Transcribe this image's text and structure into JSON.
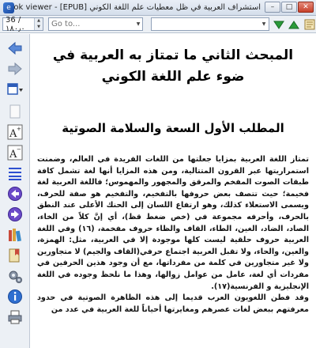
{
  "window": {
    "title": "استشراف العربية في ظل معطيات علم اللغة الكوني [EPUB] - E-book viewer",
    "minimize_glyph": "–",
    "maximize_glyph": "□",
    "close_glyph": "✕"
  },
  "toolbar": {
    "page_value": "36 / ١٨٠٫٠",
    "goto_placeholder": "Go to...",
    "search_value": "",
    "colors": {
      "next_arrow": "#2a9a3a",
      "prev_arrow": "#2a9a3a"
    }
  },
  "sidebar": {
    "items": [
      {
        "name": "back-icon"
      },
      {
        "name": "forward-icon"
      },
      {
        "name": "toggle-toc-icon"
      },
      {
        "name": "copy-icon"
      },
      {
        "name": "font-larger-icon",
        "label": "A"
      },
      {
        "name": "font-smaller-icon",
        "label": "A"
      },
      {
        "name": "table-of-contents-icon"
      },
      {
        "name": "previous-page-icon"
      },
      {
        "name": "next-page-icon"
      },
      {
        "name": "library-icon"
      },
      {
        "name": "bookmark-icon"
      },
      {
        "name": "preferences-icon"
      },
      {
        "name": "info-icon"
      },
      {
        "name": "print-icon"
      }
    ],
    "accent": "#6b4ac8"
  },
  "book": {
    "chapter_title": "المبحث الثاني ما تمتاز به العربية في ضوء علم اللغة الكوني",
    "section_title": "المطلب الأول السعة والسلامة الصوتية",
    "paragraphs": [
      "تمتاز اللغة العربية بمزايا جعلتها من اللغات الفريدة في العالم، وضمنت استمراريتها عبر القرون المتتالية، ومن هذه المزايا أنها لغة تشمل كافة طبقات الصوت المفخم والمرقق والمجهور والمهموس؛ فاللغة العربية لغة فخيمة؛ حيث تتصف بعض حروفها بالتفخيم، والتفخيم هو صفة للحرف، ويسمى الاستعلاء كذلك، وهو ارتفاع اللسان إلى الحنك الأعلى عند النطق بالحرف، وأحرفه مجموعة في (خص ضغط قظ)، أي إنَّ كلاً من الخاء، الصاد، الضاد، الغين، الطاء، القاف والظاء حروف مفخمة، (١٦) وفي اللغة العربية حروف حلقية ليست كلها موجودة إلا في العربية، مثل: الهمزة، والعين، والحاء، ولا تقبل العربية اجتماع حرفي(القاف والجيم) لا متجاورين ولا غير متجاورين في كلمة من مفرداتها، مع أن وجود هذين الحرفين في مفردات أي لغة، عامل من عوامل زوالها، وهذا ما نلحظ وجوده في اللغة الإنجليزية و الفرنسية(١٧).",
      "وقد فطن اللغويون العرب قديما إلى هذه الظاهرة الصوتية في حدود معرفتهم ببعض لغات عصرهم ومغايرتها أحياناً للغة العربية في عدد من"
    ]
  }
}
